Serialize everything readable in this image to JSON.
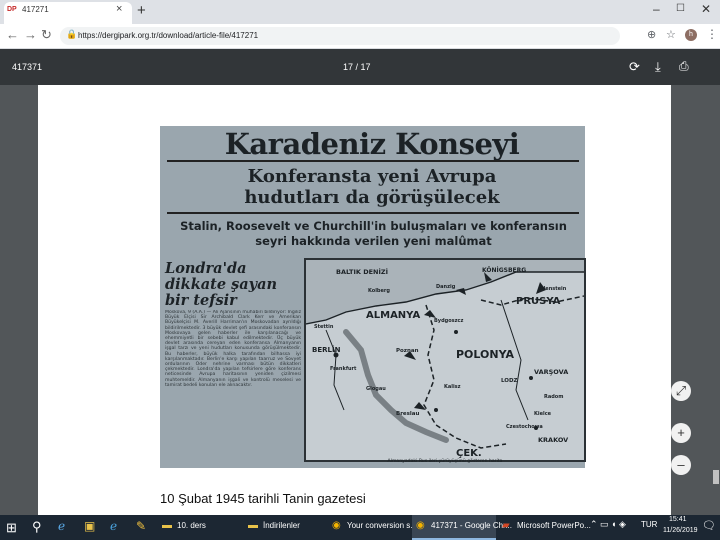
{
  "browser": {
    "tab_title": "417271",
    "tab_favicon": "DP",
    "url": "https://dergipark.org.tr/download/article-file/417271",
    "avatar_letter": "h"
  },
  "pdf_viewer": {
    "title": "417371",
    "page_indicator": "17 / 17"
  },
  "newspaper": {
    "headline": "Karadeniz Konseyi",
    "sub1": "Konferansta yeni Avrupa",
    "sub2": "hudutları da görüşülecek",
    "sub3": "Stalin, Roosevelt ve Churchill'in buluşmaları ve konferansın seyri hakkında verilen yeni malûmat",
    "side_headline": "Londra'da dikkate şayan bir tefsir",
    "side_text": "Moskova, 9 (A.A.) — Ali Ajansının muhabiri bildiriyor: İngiliz Büyük Elçisi Sir Archibald Clark Kerr ve Amerikan Büyükelçisi M. Averill Harriman'ın Moskovadan ayrıldığı bildirilmektedir. 3 büyük devlet şefi arasındaki konferansın Moskovaya gelen haberler ile karşılanacağı ve ehemmiyetli bir sebebi kabul edilmektedir. Üç büyük devlet arasında cereyan eden konferansa Almanyanın işgal tarzı ve yeni hudutları konusunda görüşülmektedir. Bu haberler, büyük halka tarafından bilhassa iyi karşılanmaktadır. Berlin'e karşı yapılan taarruz ve Sovyet ordularının Oder nehrine varması bütün dikkatleri çekmektedir. Londra'da yapılan tefsirlere göre konferans neticesinde Avrupa haritasının yeniden çizilmesi muhtemeldir. Almanyanın işgali ve kontrolü meselesi ve tamirat bedeli konuları ele alınacaktır.",
    "map": {
      "labels": {
        "baltic": "BALTIK DENİZİ",
        "konigsberg": "KÖNİGSBERG",
        "prusya": "PRUSYA",
        "almanya": "ALMANYA",
        "polonya": "POLONYA",
        "berlin": "BERLİN",
        "varsova": "VARŞOVA",
        "krakov": "KRAKOV",
        "cek": "ÇEK.",
        "stettin": "Stettin",
        "danzig": "Danzig",
        "posen": "Poznan",
        "breslau": "Breslau",
        "lodz": "LODZ",
        "kielce": "Kielce",
        "bydgoszcz": "Bydgoszcz",
        "kolberg": "Kolberg",
        "frankfurt": "Frankfurt",
        "glogau": "Glogau",
        "kalisz": "Kalisz",
        "czestochowa": "Czestochowa",
        "allenstein": "Allenstein",
        "radom": "Radom"
      },
      "caption": "Almanyadaki Rus ileri yürüyüşünü gösteren harita"
    },
    "caption": "10 Şubat 1945 tarihli Tanin gazetesi"
  },
  "taskbar": {
    "items": [
      {
        "label": "10. ders",
        "icon": "folder-icon",
        "active": false
      },
      {
        "label": "İndirilenler",
        "icon": "folder-icon",
        "active": false
      },
      {
        "label": "Your conversion s...",
        "icon": "chrome-icon",
        "active": false
      },
      {
        "label": "417371 - Google Chr...",
        "icon": "chrome-icon",
        "active": true
      },
      {
        "label": "Microsoft PowerPo...",
        "icon": "powerpoint-icon",
        "active": false
      }
    ],
    "language": "TUR",
    "time": "15:41",
    "date": "11/26/2019"
  },
  "colors": {
    "pdf_toolbar": "#323639",
    "viewer_bg": "#525659",
    "taskbar": "#1c2733",
    "newsprint": "#9aa6ae"
  }
}
